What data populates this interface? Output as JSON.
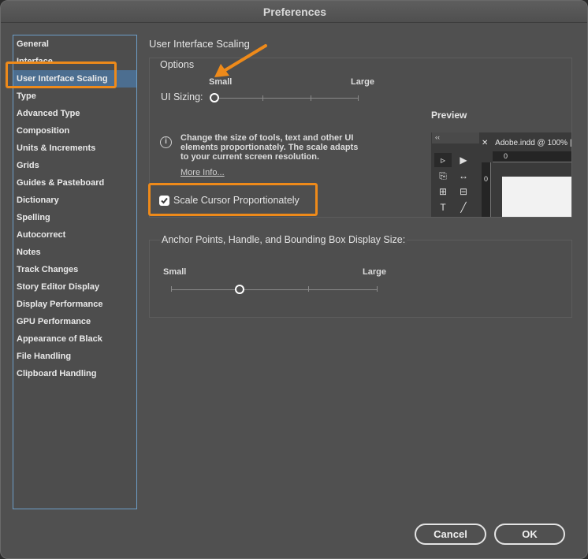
{
  "window": {
    "title": "Preferences"
  },
  "sidebar": {
    "items": [
      {
        "label": "General"
      },
      {
        "label": "Interface"
      },
      {
        "label": "User Interface Scaling"
      },
      {
        "label": "Type"
      },
      {
        "label": "Advanced Type"
      },
      {
        "label": "Composition"
      },
      {
        "label": "Units & Increments"
      },
      {
        "label": "Grids"
      },
      {
        "label": "Guides & Pasteboard"
      },
      {
        "label": "Dictionary"
      },
      {
        "label": "Spelling"
      },
      {
        "label": "Autocorrect"
      },
      {
        "label": "Notes"
      },
      {
        "label": "Track Changes"
      },
      {
        "label": "Story Editor Display"
      },
      {
        "label": "Display Performance"
      },
      {
        "label": "GPU Performance"
      },
      {
        "label": "Appearance of Black"
      },
      {
        "label": "File Handling"
      },
      {
        "label": "Clipboard Handling"
      }
    ],
    "selected": "User Interface Scaling"
  },
  "main": {
    "title": "User Interface Scaling",
    "options": {
      "heading": "Options",
      "ui_sizing_label": "UI Sizing:",
      "slider_min": "Small",
      "slider_max": "Large",
      "ui_sizing_level": 0,
      "info_text": "Change the size of tools, text and other UI elements proportionately. The scale adapts to your current screen resolution.",
      "more_info": "More Info...",
      "scale_cursor_label": "Scale Cursor Proportionately",
      "scale_cursor_checked": true,
      "preview_label": "Preview",
      "preview_tab": "Adobe.indd @ 100% |",
      "preview_ruler_top": "0",
      "preview_ruler_left": "0"
    },
    "anchor": {
      "heading": "Anchor Points, Handle, and Bounding Box Display Size:",
      "slider_min": "Small",
      "slider_max": "Large",
      "level": 0.33
    }
  },
  "footer": {
    "cancel_label": "Cancel",
    "ok_label": "OK"
  },
  "colors": {
    "highlight": "#ee8a1a",
    "selection": "#4c6e90",
    "sidebar_border": "#6d9ec8"
  }
}
